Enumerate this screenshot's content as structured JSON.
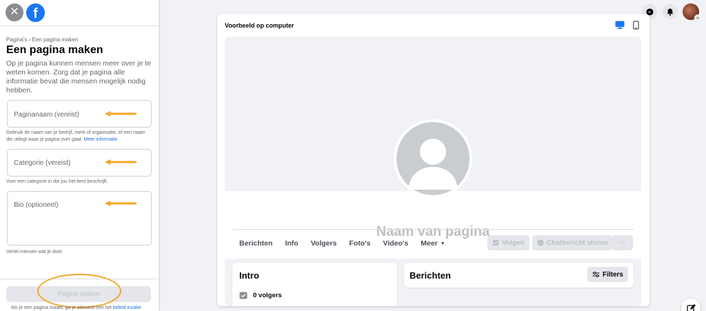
{
  "left_panel": {
    "breadcrumb": "Pagina's › Een pagina maken",
    "title": "Een pagina maken",
    "description": "Op je pagina kunnen mensen meer over je te weten komen. Zorg dat je pagina alle informatie bevat die mensen mogelijk nodig hebben.",
    "name_field": {
      "placeholder": "Paginanaam (vereist)",
      "help": "Gebruik de naam van je bedrijf, merk of organisatie, of een naam die uitlegt waar je pagina over gaat.",
      "help_link": "Meer informatie"
    },
    "category_field": {
      "placeholder": "Categorie (vereist)",
      "help": "Voer een categorie in die jou het best beschrijft."
    },
    "bio_field": {
      "placeholder": "Bio (optioneel)",
      "help": "Vertel mensen wat je doet."
    },
    "create_button": "Pagina maken",
    "terms_text": "Als je een pagina maakt, ga je akkoord met het",
    "terms_link": "beleid inzake"
  },
  "preview": {
    "title": "Voorbeeld op computer",
    "page_name": "Naam van pagina",
    "tabs": [
      "Berichten",
      "Info",
      "Volgers",
      "Foto's",
      "Video's"
    ],
    "more_tab": "Meer",
    "follow_button": "Volgen",
    "message_button": "Chatbericht sturen",
    "more_button": "···",
    "intro_title": "Intro",
    "followers_text": "0 volgers",
    "posts_title": "Berichten",
    "filters_button": "Filters"
  },
  "icons": {
    "close": "close-icon",
    "facebook": "facebook-logo-icon",
    "messenger": "messenger-icon",
    "notifications": "bell-icon",
    "compose": "compose-icon"
  },
  "colors": {
    "accent": "#1877f2",
    "annotation": "#f5a623",
    "background": "#f0f2f5"
  }
}
